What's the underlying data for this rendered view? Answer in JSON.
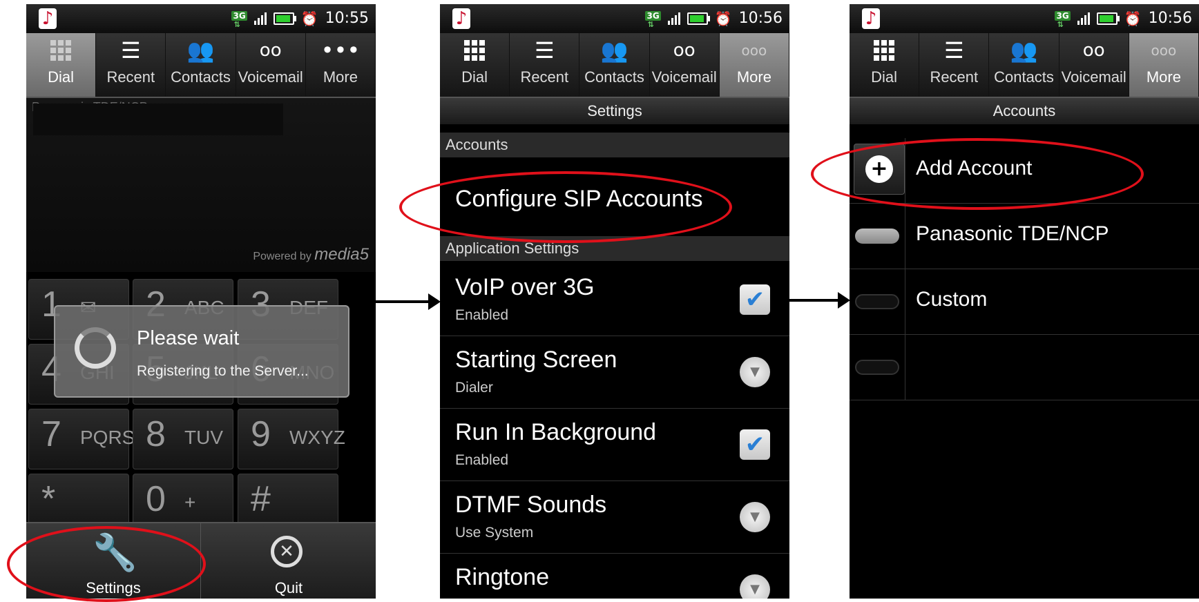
{
  "status": {
    "network": "3G",
    "time_1": "10:55",
    "time_2": "10:56",
    "time_3": "10:56"
  },
  "tabs": [
    "Dial",
    "Recent",
    "Contacts",
    "Voicemail",
    "More"
  ],
  "dialer": {
    "partial_account_text": "Panasonic TDE/NCP",
    "powered_by": "Powered by",
    "brand": "media5",
    "keys": [
      {
        "num": "1",
        "letters": "✉"
      },
      {
        "num": "2",
        "letters": "ABC"
      },
      {
        "num": "3",
        "letters": "DEF"
      },
      {
        "num": "4",
        "letters": "GHI"
      },
      {
        "num": "5",
        "letters": "JKL"
      },
      {
        "num": "6",
        "letters": "MNO"
      },
      {
        "num": "7",
        "letters": "PQRS"
      },
      {
        "num": "8",
        "letters": "TUV"
      },
      {
        "num": "9",
        "letters": "WXYZ"
      },
      {
        "num": "*",
        "letters": ""
      },
      {
        "num": "0",
        "letters": "+"
      },
      {
        "num": "#",
        "letters": ""
      }
    ],
    "dialog": {
      "title": "Please wait",
      "message": "Registering to the Server..."
    },
    "menu": {
      "settings": "Settings",
      "quit": "Quit"
    }
  },
  "settings": {
    "header": "Settings",
    "section_accounts": "Accounts",
    "configure": "Configure SIP Accounts",
    "section_app": "Application Settings",
    "items": [
      {
        "title": "VoIP over 3G",
        "sub": "Enabled",
        "control": "checkbox",
        "checked": true
      },
      {
        "title": "Starting Screen",
        "sub": "Dialer",
        "control": "dropdown"
      },
      {
        "title": "Run In Background",
        "sub": "Enabled",
        "control": "checkbox",
        "checked": true
      },
      {
        "title": "DTMF Sounds",
        "sub": "Use System",
        "control": "dropdown"
      },
      {
        "title": "Ringtone",
        "sub": "",
        "control": "dropdown"
      }
    ]
  },
  "accounts": {
    "header": "Accounts",
    "items": [
      {
        "label": "Add Account",
        "icon": "add-circle-icon"
      },
      {
        "label": "Panasonic TDE/NCP",
        "icon": "account-pill-grey"
      },
      {
        "label": "Custom",
        "icon": "account-pill-dark"
      },
      {
        "label": "",
        "icon": "account-pill-dark"
      }
    ]
  },
  "colors": {
    "highlight_ring": "#e0101a",
    "accent_blue": "#2a7fd4",
    "active_tab": "#8a8a8a"
  }
}
